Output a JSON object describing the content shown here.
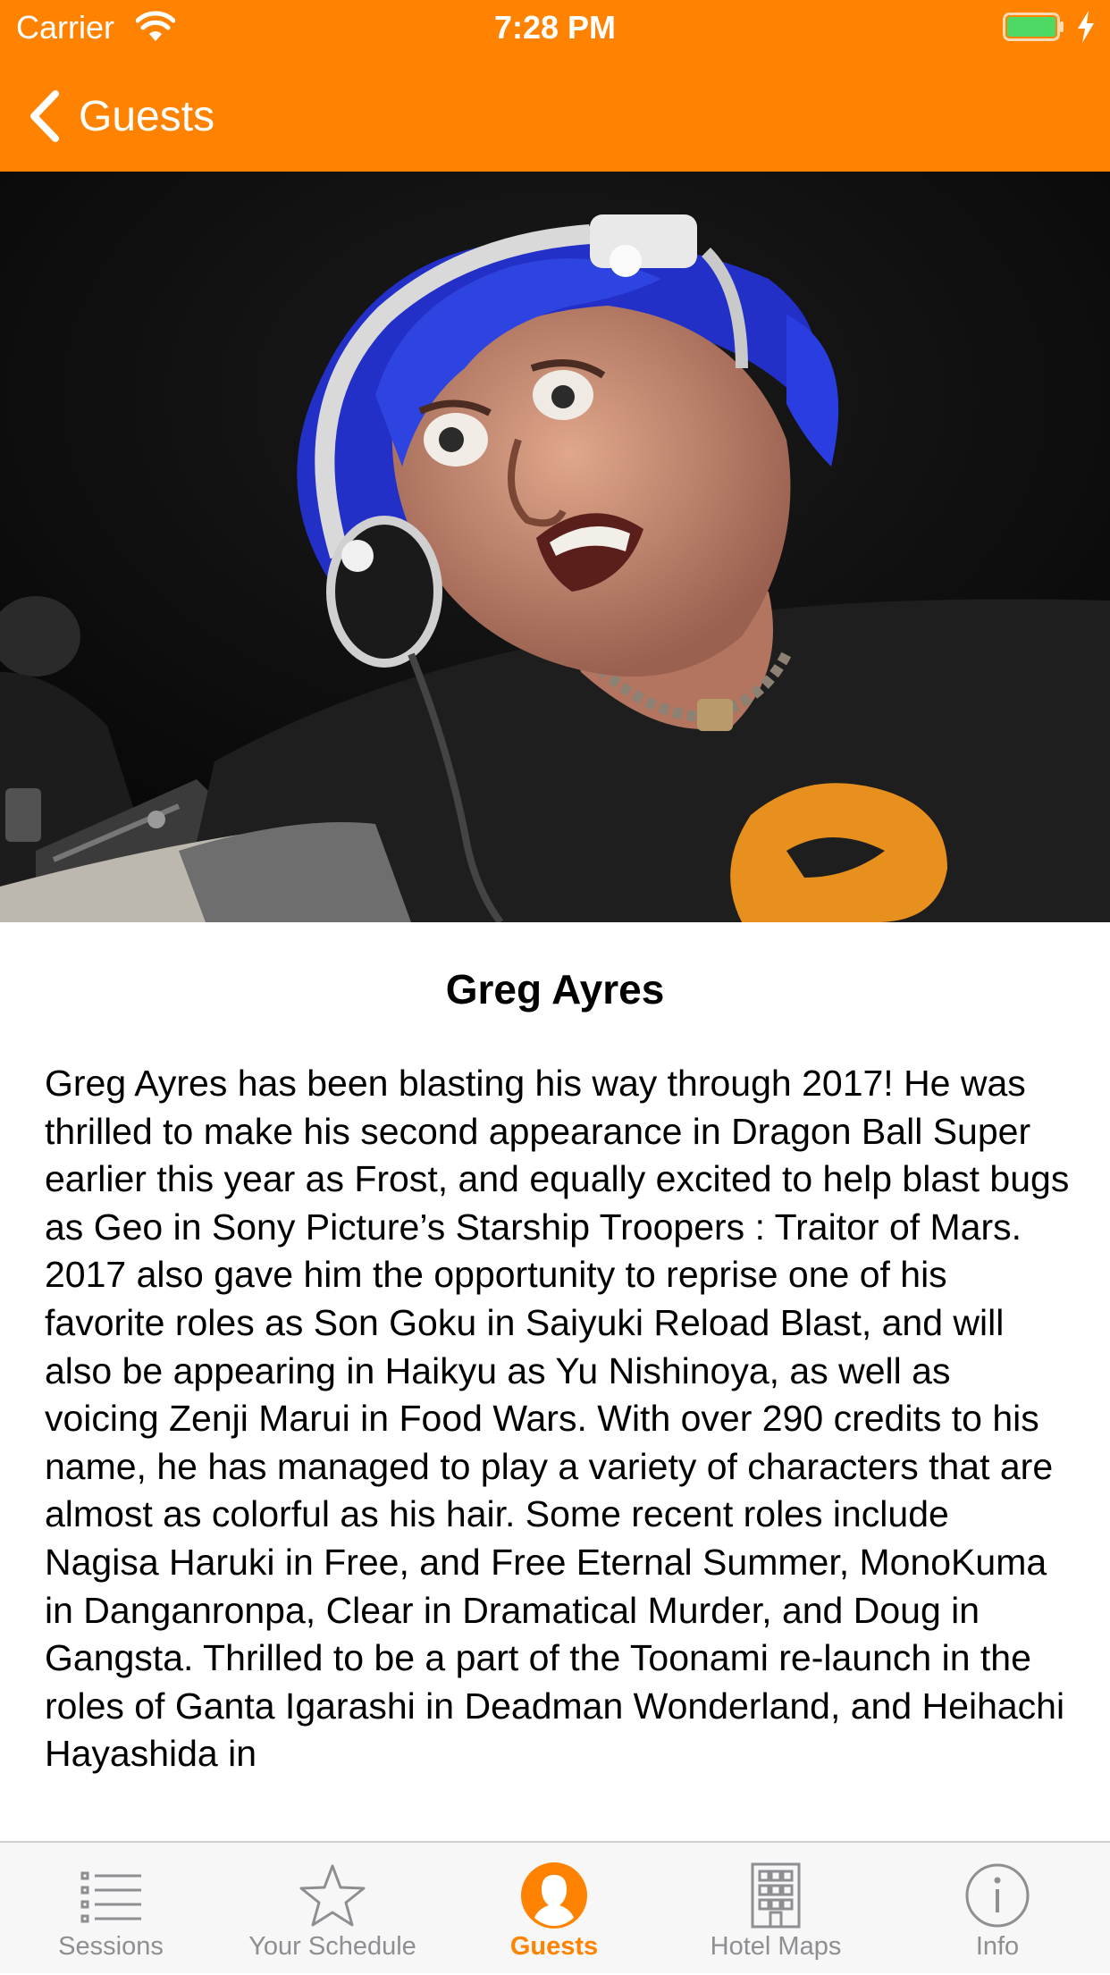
{
  "status_bar": {
    "carrier": "Carrier",
    "time": "7:28 PM",
    "battery_color": "#4CD964"
  },
  "nav": {
    "back_label": "Guests",
    "accent_color": "#FF8200"
  },
  "guest": {
    "name": "Greg Ayres",
    "photo_icon": "guest-portrait",
    "bio": "Greg Ayres has been blasting his way through 2017!  He was thrilled to make his second appearance in Dragon Ball Super earlier this year as Frost, and equally excited to help blast bugs as Geo in Sony Picture’s Starship Troopers : Traitor of Mars. 2017 also gave him the opportunity to reprise one of his favorite roles as Son Goku in Saiyuki Reload Blast, and will also be appearing in Haikyu as Yu Nishinoya, as well as voicing Zenji Marui in Food Wars. With over 290 credits to his name, he has managed to play a variety of characters that are almost as colorful as his hair.  Some recent roles include Nagisa Haruki in Free, and Free Eternal Summer, MonoKuma in Danganronpa, Clear in Dramatical Murder, and Doug in Gangsta. Thrilled to be a part of the Toonami re-launch in the roles of Ganta Igarashi in Deadman Wonderland, and Heihachi Hayashida in"
  },
  "tabs": [
    {
      "label": "Sessions",
      "icon": "list-icon"
    },
    {
      "label": "Your Schedule",
      "icon": "star-icon"
    },
    {
      "label": "Guests",
      "icon": "person-icon",
      "active": true
    },
    {
      "label": "Hotel Maps",
      "icon": "building-icon"
    },
    {
      "label": "Info",
      "icon": "info-icon"
    }
  ]
}
